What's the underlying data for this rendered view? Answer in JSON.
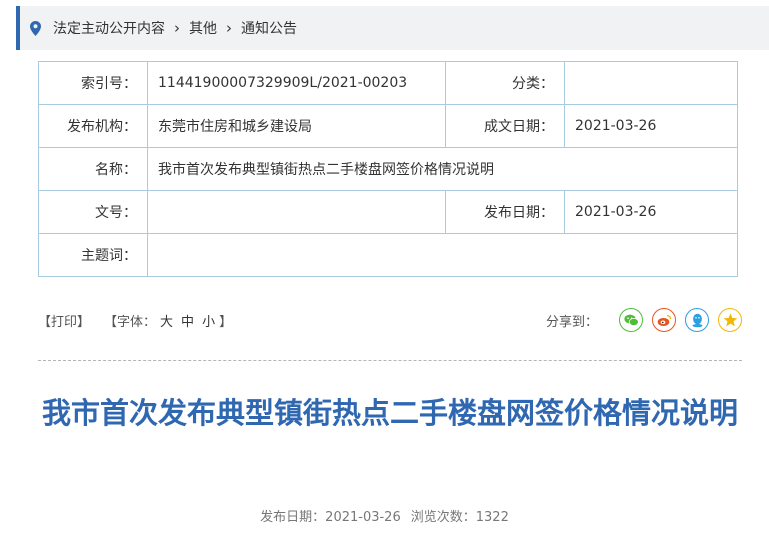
{
  "breadcrumb": {
    "items": [
      "法定主动公开内容",
      "其他",
      "通知公告"
    ],
    "separator": "›"
  },
  "meta": {
    "index_label": "索引号：",
    "index_value": "11441900007329909L/2021-00203",
    "category_label": "分类：",
    "category_value": "",
    "publisher_label": "发布机构：",
    "publisher_value": "东莞市住房和城乡建设局",
    "created_label": "成文日期：",
    "created_value": "2021-03-26",
    "name_label": "名称：",
    "name_value": "我市首次发布典型镇街热点二手楼盘网签价格情况说明",
    "docno_label": "文号：",
    "docno_value": "",
    "pubdate_label": "发布日期：",
    "pubdate_value": "2021-03-26",
    "keywords_label": "主题词：",
    "keywords_value": ""
  },
  "toolbar": {
    "print": "【打印】",
    "font_open": "【字体：",
    "font_large": "大",
    "font_medium": "中",
    "font_small": "小",
    "font_close": "】",
    "share_label": "分享到：",
    "share_icons": [
      "wechat-icon",
      "weibo-icon",
      "qq-icon",
      "qzone-icon"
    ]
  },
  "article": {
    "title": "我市首次发布典型镇街热点二手楼盘网签价格情况说明",
    "date_label": "发布日期：",
    "date_value": "2021-03-26",
    "views_label": "浏览次数：",
    "views_value": "1322"
  },
  "colors": {
    "accent": "#2f67b1",
    "table_border": "#a9cbe0",
    "breadcrumb_bg": "#f1f2f4",
    "wechat": "#4fbd38",
    "weibo": "#e8541e",
    "qq": "#2b9fe0",
    "qzone": "#f2b705"
  }
}
